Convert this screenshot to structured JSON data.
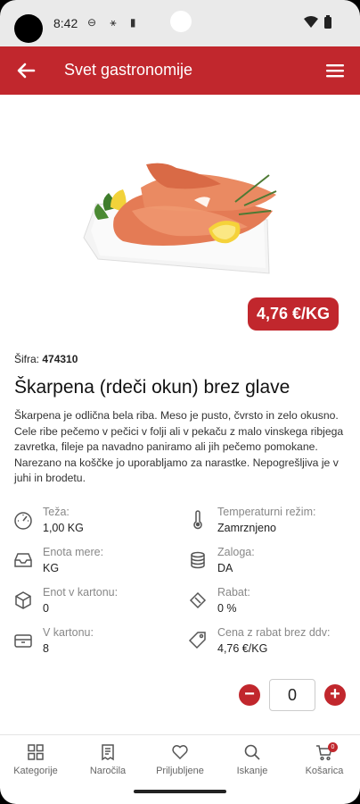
{
  "status_bar": {
    "time": "8:42",
    "icons": "⊖ ⚹ ▮"
  },
  "app_bar": {
    "title": "Svet gastronomije"
  },
  "product": {
    "price": "4,76 €/KG",
    "sku_label": "Šifra:",
    "sku_value": "474310",
    "title": "Škarpena (rdeči okun) brez glave",
    "description": "Škarpena je odlična bela riba. Meso je pusto, čvrsto in zelo okusno. Cele ribe pečemo v pečici v folji ali v pekaču z malo vinskega ribjega zavretka, fileje pa navadno paniramo ali jih pečemo pomokane. Narezano na koščke jo uporabljamo za narastke. Nepogrešljiva je v juhi in brodetu."
  },
  "specs": [
    {
      "icon": "gauge-icon",
      "label": "Teža:",
      "value": "1,00 KG"
    },
    {
      "icon": "thermometer-icon",
      "label": "Temperaturni režim:",
      "value": "Zamrznjeno"
    },
    {
      "icon": "tray-icon",
      "label": "Enota mere:",
      "value": "KG"
    },
    {
      "icon": "coins-icon",
      "label": "Zaloga:",
      "value": "DA"
    },
    {
      "icon": "box-icon",
      "label": "Enot v kartonu:",
      "value": "0"
    },
    {
      "icon": "ticket-icon",
      "label": "Rabat:",
      "value": "0 %"
    },
    {
      "icon": "carton-icon",
      "label": "V kartonu:",
      "value": "8"
    },
    {
      "icon": "tag-icon",
      "label": "Cena z rabat brez ddv:",
      "value": "4,76 €/KG"
    }
  ],
  "quantity": {
    "value": "0"
  },
  "bottom_nav": [
    {
      "icon": "grid-icon",
      "label": "Kategorije"
    },
    {
      "icon": "receipt-icon",
      "label": "Naročila"
    },
    {
      "icon": "heart-icon",
      "label": "Priljubljene"
    },
    {
      "icon": "search-icon",
      "label": "Iskanje"
    },
    {
      "icon": "cart-icon",
      "label": "Košarica",
      "badge": "0"
    }
  ],
  "colors": {
    "brand": "#c1272d"
  }
}
